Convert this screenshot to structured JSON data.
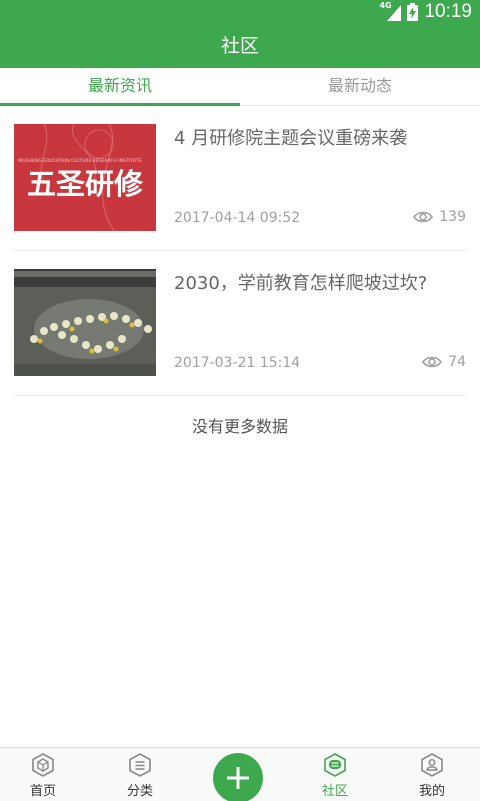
{
  "status_bar": {
    "network": "4G",
    "time": "10:19"
  },
  "header": {
    "title": "社区"
  },
  "tabs": [
    {
      "label": "最新资讯",
      "active": true
    },
    {
      "label": "最新动态",
      "active": false
    }
  ],
  "articles": [
    {
      "title": "4 月研修院主题会议重磅来袭",
      "date": "2017-04-14 09:52",
      "views": "139",
      "thumb_text": "五圣研修",
      "thumb_subtext": "WUSHENG EDUCATION CULTURE RESEARCH INSTITUTE"
    },
    {
      "title": "2030，学前教育怎样爬坡过坎?",
      "date": "2017-03-21 15:14",
      "views": "74"
    }
  ],
  "no_more": "没有更多数据",
  "bottom_nav": [
    {
      "label": "首页",
      "icon": "home-icon"
    },
    {
      "label": "分类",
      "icon": "category-icon"
    },
    {
      "label": "",
      "icon": "add-icon"
    },
    {
      "label": "社区",
      "icon": "community-icon",
      "active": true
    },
    {
      "label": "我的",
      "icon": "profile-icon"
    }
  ],
  "colors": {
    "primary": "#3ea84e",
    "thumb_red": "#c8373d"
  }
}
